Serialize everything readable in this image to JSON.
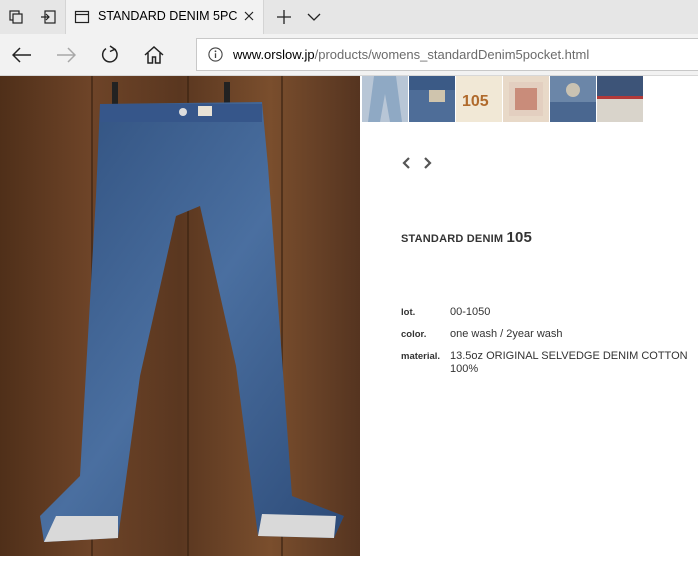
{
  "browser": {
    "tab_title": "STANDARD DENIM 5PC",
    "url_domain": "www.orslow.jp",
    "url_path": "/products/womens_standardDenim5pocket.html"
  },
  "product": {
    "title_prefix": "STANDARD DENIM",
    "title_number": "105",
    "specs": [
      {
        "label": "lot.",
        "value": "00-1050"
      },
      {
        "label": "color.",
        "value": "one wash / 2year wash"
      },
      {
        "label": "material.",
        "value": "13.5oz ORIGINAL SELVEDGE DENIM COTTON 100%"
      }
    ],
    "thumbnail_label": "105"
  },
  "colors": {
    "tabstrip": "#e6e6e6",
    "navbar": "#f2f2f2",
    "wood": "#5e3a22",
    "denim": "#3f5f8e"
  }
}
